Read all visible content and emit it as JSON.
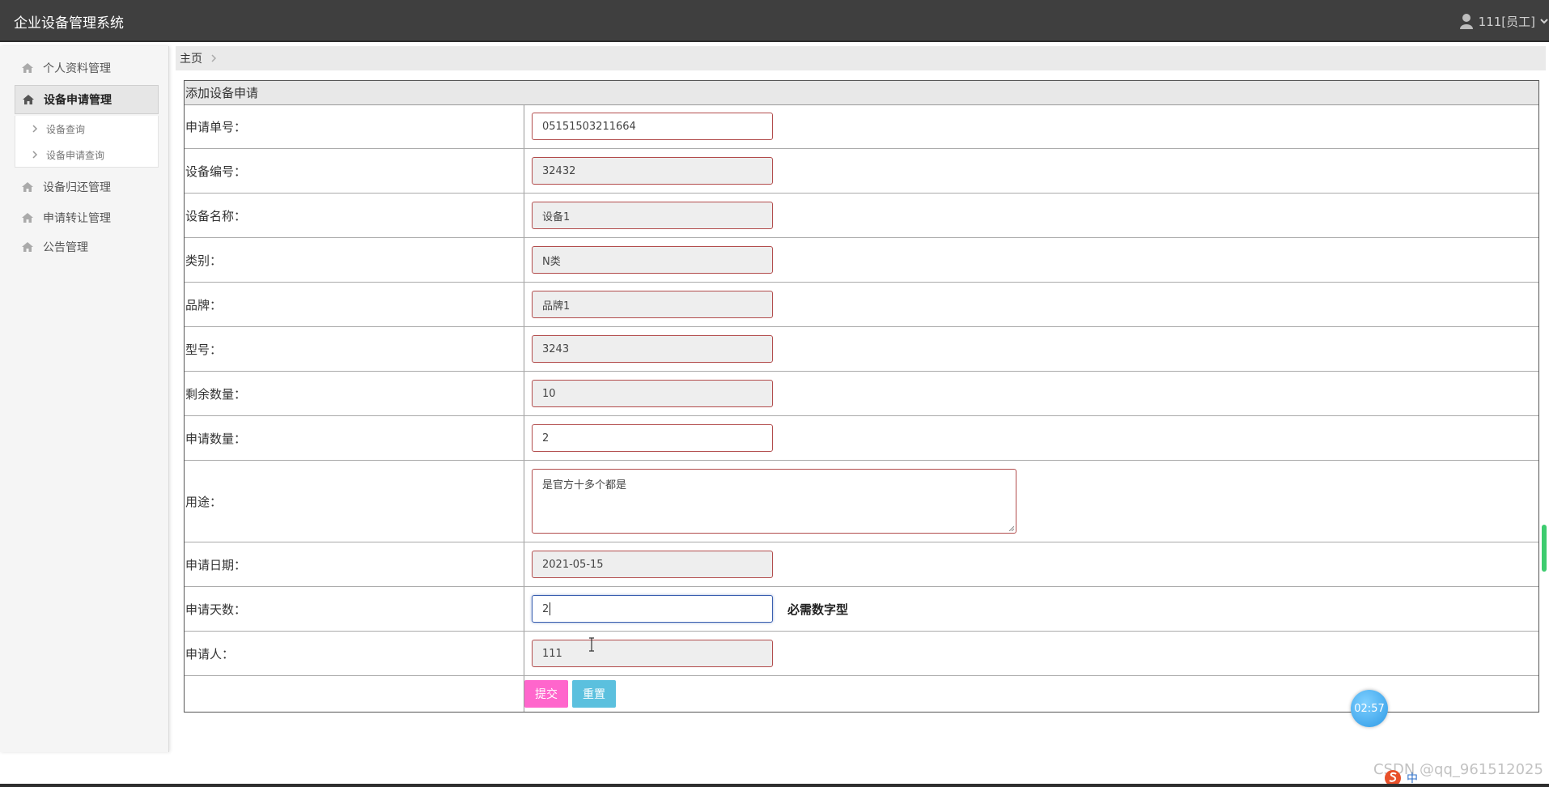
{
  "header": {
    "app_title": "企业设备管理系统",
    "user_label": "111[员工]"
  },
  "sidebar": {
    "items": [
      {
        "label": "个人资料管理"
      },
      {
        "label": "设备申请管理"
      },
      {
        "label": "设备归还管理"
      },
      {
        "label": "申请转让管理"
      },
      {
        "label": "公告管理"
      }
    ],
    "subitems": [
      {
        "label": "设备查询"
      },
      {
        "label": "设备申请查询"
      }
    ]
  },
  "breadcrumb": {
    "home": "主页"
  },
  "form": {
    "title": "添加设备申请",
    "fields": [
      {
        "label": "申请单号：",
        "value": "05151503211664"
      },
      {
        "label": "设备编号：",
        "value": "32432"
      },
      {
        "label": "设备名称：",
        "value": "设备1"
      },
      {
        "label": "类别：",
        "value": "N类"
      },
      {
        "label": "品牌：",
        "value": "品牌1"
      },
      {
        "label": "型号：",
        "value": "3243"
      },
      {
        "label": "剩余数量：",
        "value": "10"
      },
      {
        "label": "申请数量：",
        "value": "2"
      },
      {
        "label": "用途：",
        "value": "是官方十多个都是"
      },
      {
        "label": "申请日期：",
        "value": "2021-05-15"
      },
      {
        "label": "申请天数：",
        "value": "2",
        "hint": "必需数字型"
      },
      {
        "label": "申请人：",
        "value": "111"
      }
    ],
    "submit_label": "提交",
    "reset_label": "重置"
  },
  "overlay": {
    "timer": "02:57",
    "watermark": "CSDN @qq_961512025",
    "tray_text": "中"
  },
  "colors": {
    "topbar": "#3f3f3f",
    "submit_button": "#ff66cc",
    "reset_button": "#5bc0de",
    "field_border": "#b24c4c",
    "readonly_bg": "#eeeeee"
  }
}
